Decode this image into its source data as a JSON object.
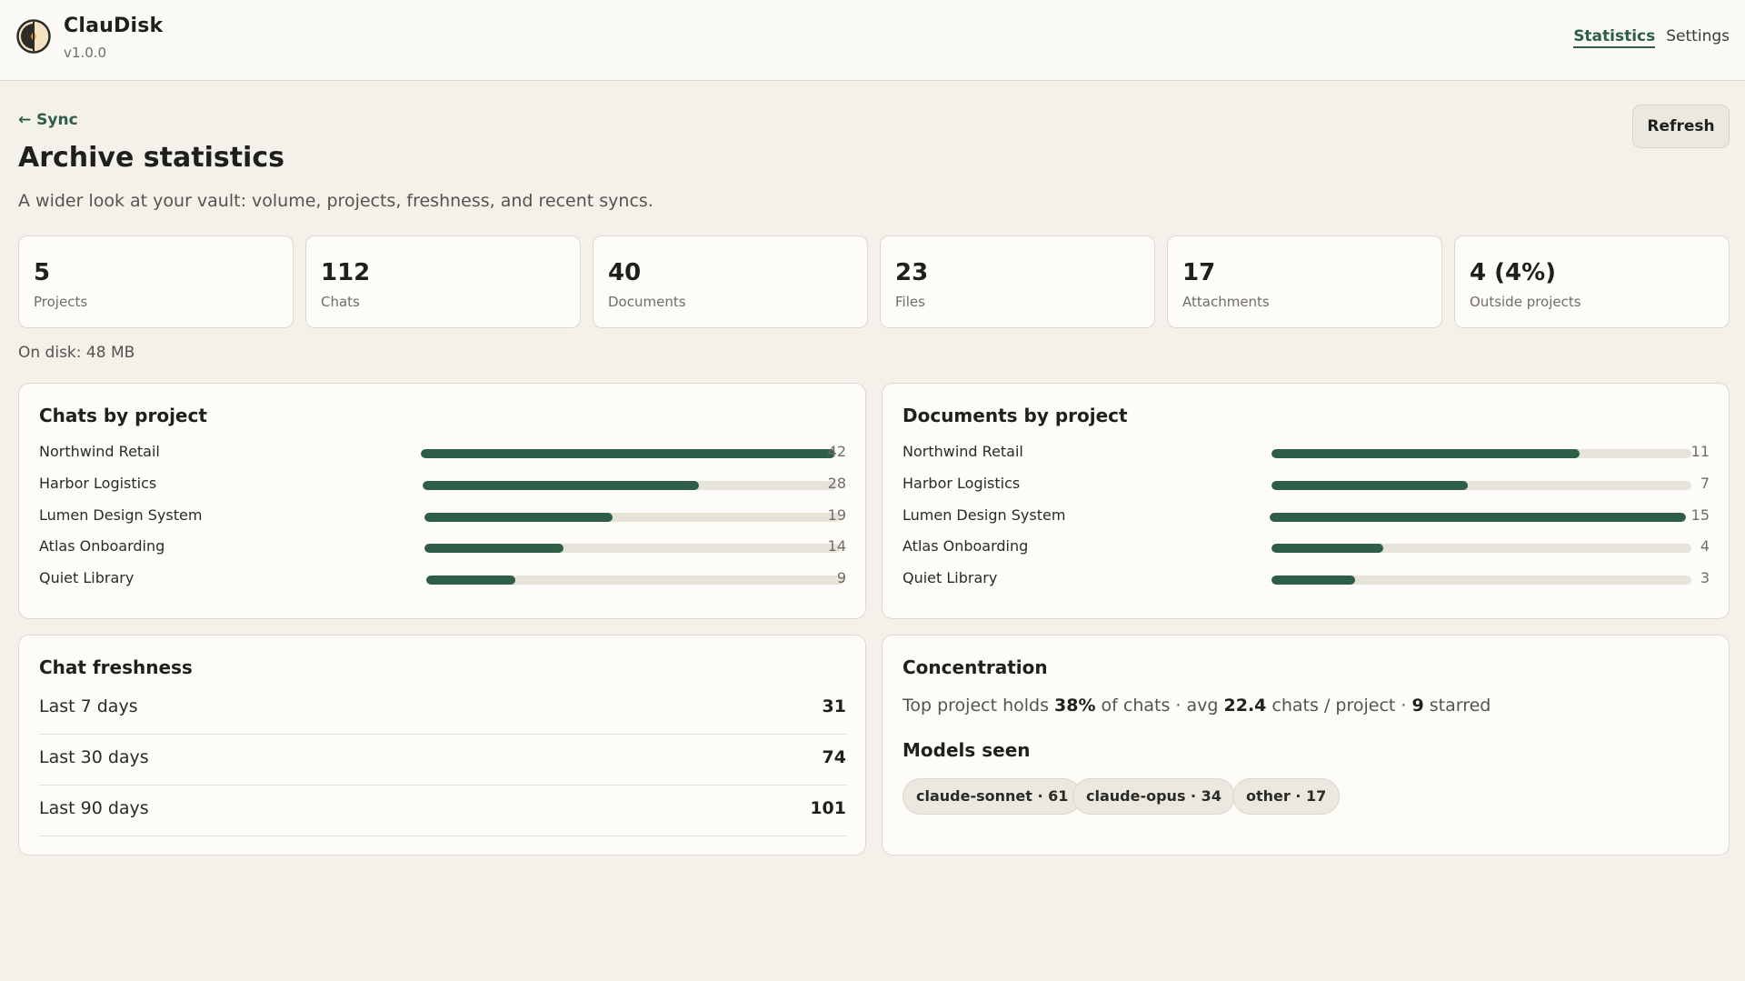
{
  "app": {
    "name": "ClauDisk",
    "version": "v1.0.0"
  },
  "nav": {
    "statistics": "Statistics",
    "settings": "Settings"
  },
  "page": {
    "back_link": "← Sync",
    "title": "Archive statistics",
    "subtitle": "A wider look at your vault: volume, projects, freshness, and recent syncs.",
    "refresh": "Refresh",
    "disk": "On disk: 48 MB"
  },
  "stats": [
    {
      "value": "5",
      "label": "Projects"
    },
    {
      "value": "112",
      "label": "Chats"
    },
    {
      "value": "40",
      "label": "Documents"
    },
    {
      "value": "23",
      "label": "Files"
    },
    {
      "value": "17",
      "label": "Attachments"
    },
    {
      "value": "4 (4%)",
      "label": "Outside projects"
    }
  ],
  "chats_by_project": {
    "title": "Chats by project",
    "rows": [
      {
        "name": "Northwind Retail",
        "count": "42",
        "fill": 1.0
      },
      {
        "name": "Harbor Logistics",
        "count": "28",
        "fill": 0.667
      },
      {
        "name": "Lumen Design System",
        "count": "19",
        "fill": 0.452
      },
      {
        "name": "Atlas Onboarding",
        "count": "14",
        "fill": 0.333
      },
      {
        "name": "Quiet Library",
        "count": "9",
        "fill": 0.214
      }
    ]
  },
  "documents_by_project": {
    "title": "Documents by project",
    "rows": [
      {
        "name": "Northwind Retail",
        "count": "11",
        "fill": 0.733
      },
      {
        "name": "Harbor Logistics",
        "count": "7",
        "fill": 0.467
      },
      {
        "name": "Lumen Design System",
        "count": "15",
        "fill": 1.0
      },
      {
        "name": "Atlas Onboarding",
        "count": "4",
        "fill": 0.267
      },
      {
        "name": "Quiet Library",
        "count": "3",
        "fill": 0.2
      }
    ]
  },
  "freshness": {
    "title": "Chat freshness",
    "rows": [
      {
        "label": "Last 7 days",
        "value": "31"
      },
      {
        "label": "Last 30 days",
        "value": "74"
      },
      {
        "label": "Last 90 days",
        "value": "101"
      }
    ]
  },
  "concentration": {
    "title": "Concentration",
    "t1": "Top project holds ",
    "v1": "38%",
    "t2": " of chats · avg ",
    "v2": "22.4",
    "t3": " chats / project · ",
    "v3": "9",
    "t4": " starred",
    "models_title": "Models seen",
    "models": [
      "claude-sonnet · 61",
      "claude-opus · 34",
      "other · 17"
    ]
  },
  "colors": {
    "accent": "#2f5e48",
    "track": "#e6e3d9",
    "background": "#f3f1ea"
  }
}
